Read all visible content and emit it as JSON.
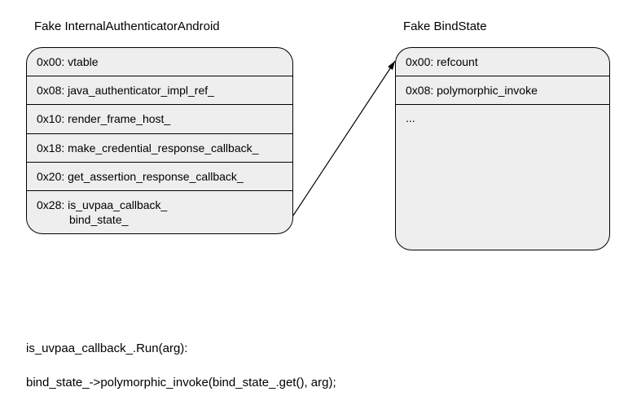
{
  "left": {
    "title": "Fake InternalAuthenticatorAndroid",
    "rows": [
      "0x00: vtable",
      "0x08: java_authenticator_impl_ref_",
      "0x10: render_frame_host_",
      "0x18: make_credential_response_callback_",
      "0x20: get_assertion_response_callback_"
    ],
    "last_row": {
      "line1": "0x28: is_uvpaa_callback_",
      "line2": "bind_state_"
    }
  },
  "right": {
    "title": "Fake BindState",
    "rows": [
      "0x00: refcount",
      "0x08: polymorphic_invoke"
    ],
    "filler": "..."
  },
  "code": {
    "line1": "is_uvpaa_callback_.Run(arg):",
    "line2": "bind_state_->polymorphic_invoke(bind_state_.get(), arg);"
  }
}
